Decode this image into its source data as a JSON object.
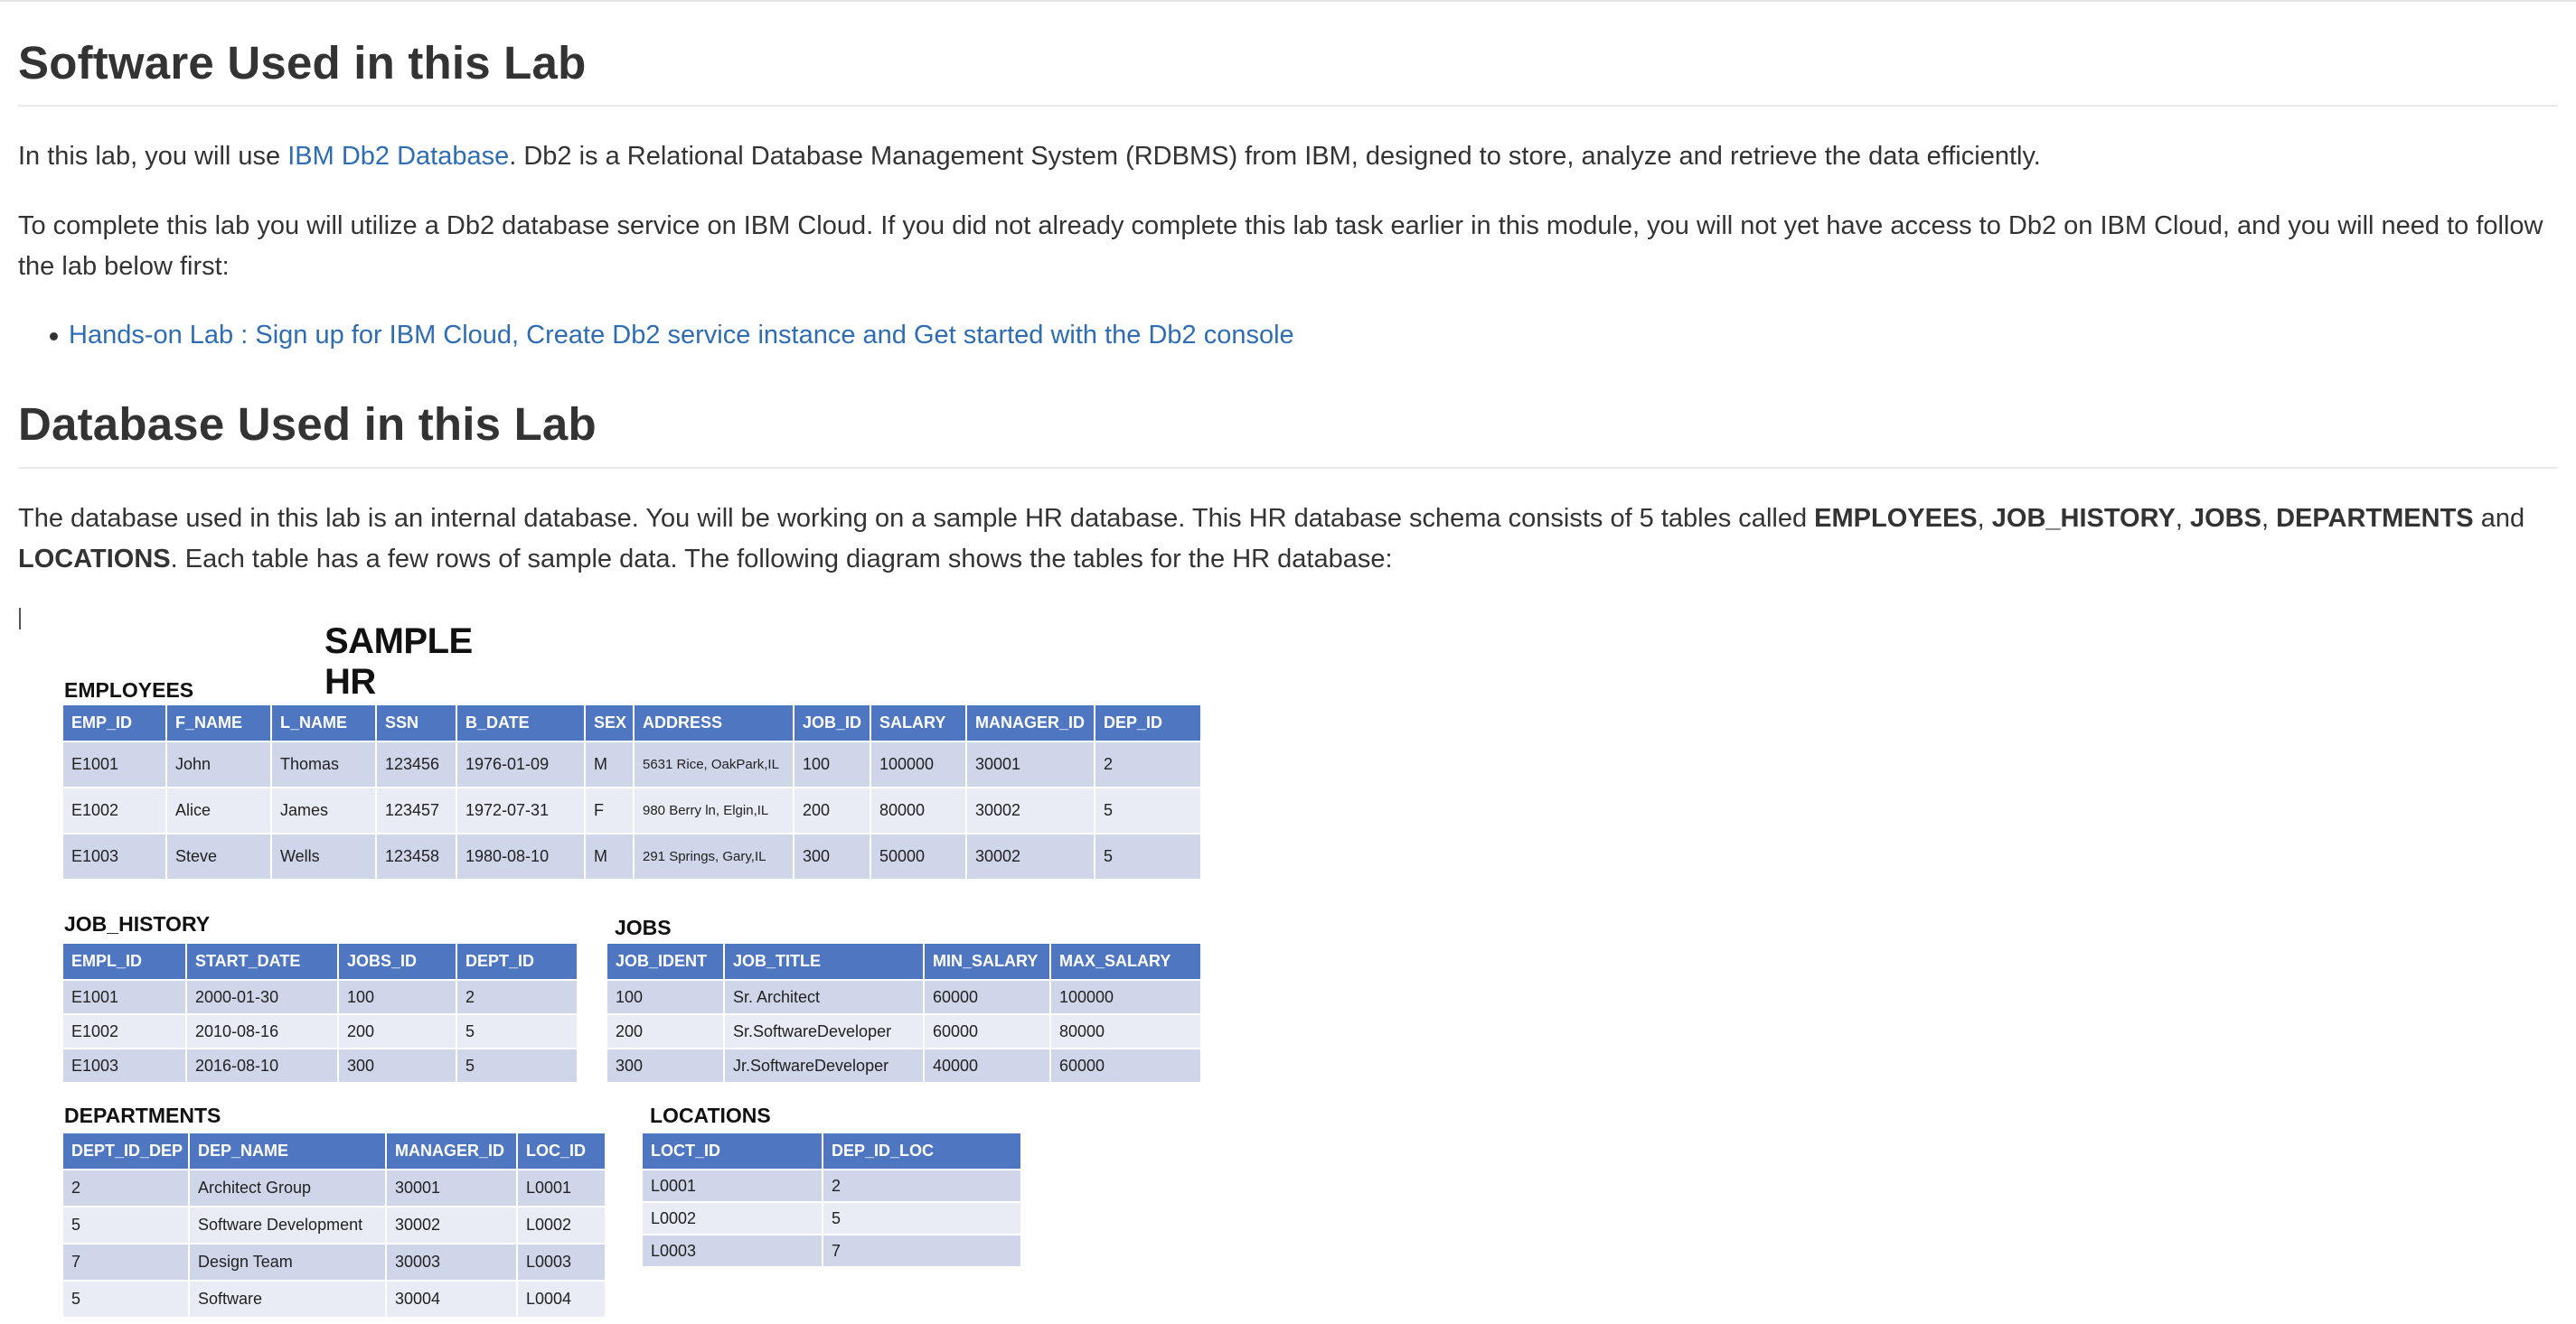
{
  "software_section": {
    "heading": "Software Used in this Lab",
    "intro_prefix": "In this lab, you will use ",
    "intro_link": "IBM Db2 Database",
    "intro_suffix": ". Db2 is a Relational Database Management System (RDBMS) from IBM, designed to store, analyze and retrieve the data efficiently.",
    "complete_text": "To complete this lab you will utilize a Db2 database service on IBM Cloud. If you did not already complete this lab task earlier in this module, you will not yet have access to Db2 on IBM Cloud, and you will need to follow the lab below first:",
    "bullet_link": "Hands-on Lab : Sign up for IBM Cloud, Create Db2 service instance and Get started with the Db2 console"
  },
  "database_section": {
    "heading": "Database Used in this Lab",
    "text_1": "The database used in this lab is an internal database. You will be working on a sample HR database. This HR database schema consists of 5 tables called ",
    "kw_employees": "EMPLOYEES",
    "sep_1": ", ",
    "kw_job_history": "JOB_HISTORY",
    "sep_2": ", ",
    "kw_jobs": "JOBS",
    "sep_3": ", ",
    "kw_departments": "DEPARTMENTS",
    "sep_4": " and ",
    "kw_locations": "LOCATIONS",
    "text_2": ". Each table has a few rows of sample data. The following diagram shows the tables for the HR database:"
  },
  "diagram": {
    "title": "SAMPLE HR DATABASE TABLES",
    "employees": {
      "name": "EMPLOYEES",
      "columns": [
        "EMP_ID",
        "F_NAME",
        "L_NAME",
        "SSN",
        "B_DATE",
        "SEX",
        "ADDRESS",
        "JOB_ID",
        "SALARY",
        "MANAGER_ID",
        "DEP_ID"
      ],
      "rows": [
        [
          "E1001",
          "John",
          "Thomas",
          "123456",
          "1976-01-09",
          "M",
          "5631 Rice, OakPark,IL",
          "100",
          "100000",
          "30001",
          "2"
        ],
        [
          "E1002",
          "Alice",
          "James",
          "123457",
          "1972-07-31",
          "F",
          "980 Berry ln, Elgin,IL",
          "200",
          "80000",
          "30002",
          "5"
        ],
        [
          "E1003",
          "Steve",
          "Wells",
          "123458",
          "1980-08-10",
          "M",
          "291 Springs, Gary,IL",
          "300",
          "50000",
          "30002",
          "5"
        ]
      ]
    },
    "job_history": {
      "name": "JOB_HISTORY",
      "columns": [
        "EMPL_ID",
        "START_DATE",
        "JOBS_ID",
        "DEPT_ID"
      ],
      "rows": [
        [
          "E1001",
          "2000-01-30",
          "100",
          "2"
        ],
        [
          "E1002",
          "2010-08-16",
          "200",
          "5"
        ],
        [
          "E1003",
          "2016-08-10",
          "300",
          "5"
        ]
      ]
    },
    "jobs": {
      "name": "JOBS",
      "columns": [
        "JOB_IDENT",
        "JOB_TITLE",
        "MIN_SALARY",
        "MAX_SALARY"
      ],
      "rows": [
        [
          "100",
          "Sr. Architect",
          "60000",
          "100000"
        ],
        [
          "200",
          "Sr.SoftwareDeveloper",
          "60000",
          "80000"
        ],
        [
          "300",
          "Jr.SoftwareDeveloper",
          "40000",
          "60000"
        ]
      ]
    },
    "departments": {
      "name": "DEPARTMENTS",
      "columns": [
        "DEPT_ID_DEP",
        "DEP_NAME",
        "MANAGER_ID",
        "LOC_ID"
      ],
      "rows": [
        [
          "2",
          "Architect Group",
          "30001",
          "L0001"
        ],
        [
          "5",
          "Software Development",
          "30002",
          "L0002"
        ],
        [
          "7",
          "Design Team",
          "30003",
          "L0003"
        ],
        [
          "5",
          "Software",
          "30004",
          "L0004"
        ]
      ]
    },
    "locations": {
      "name": "LOCATIONS",
      "columns": [
        "LOCT_ID",
        "DEP_ID_LOC"
      ],
      "rows": [
        [
          "L0001",
          "2"
        ],
        [
          "L0002",
          "5"
        ],
        [
          "L0003",
          "7"
        ]
      ]
    }
  }
}
